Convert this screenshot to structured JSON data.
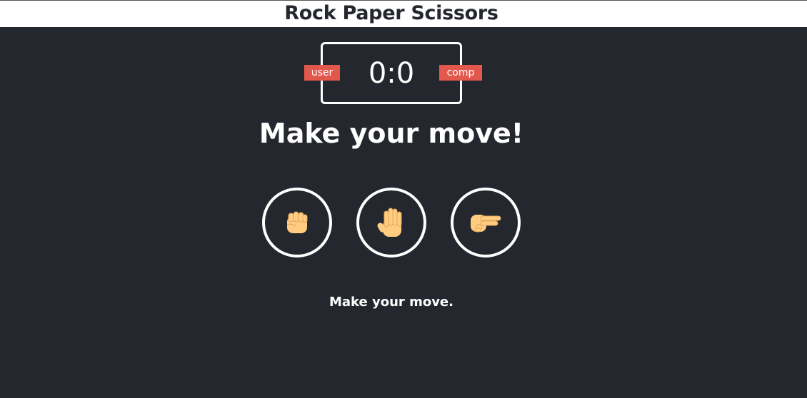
{
  "title": "Rock Paper Scissors",
  "scoreboard": {
    "score": "0:0",
    "user_label": "user",
    "comp_label": "comp"
  },
  "message": "Make your move!",
  "choices": [
    {
      "name": "rock",
      "icon": "fist-icon"
    },
    {
      "name": "paper",
      "icon": "raised-hand-icon"
    },
    {
      "name": "scissors",
      "icon": "victory-hand-icon"
    }
  ],
  "action_message": "Make your move.",
  "colors": {
    "background": "#24272e",
    "badge": "#e2584d",
    "skin": "#ffcc80"
  }
}
